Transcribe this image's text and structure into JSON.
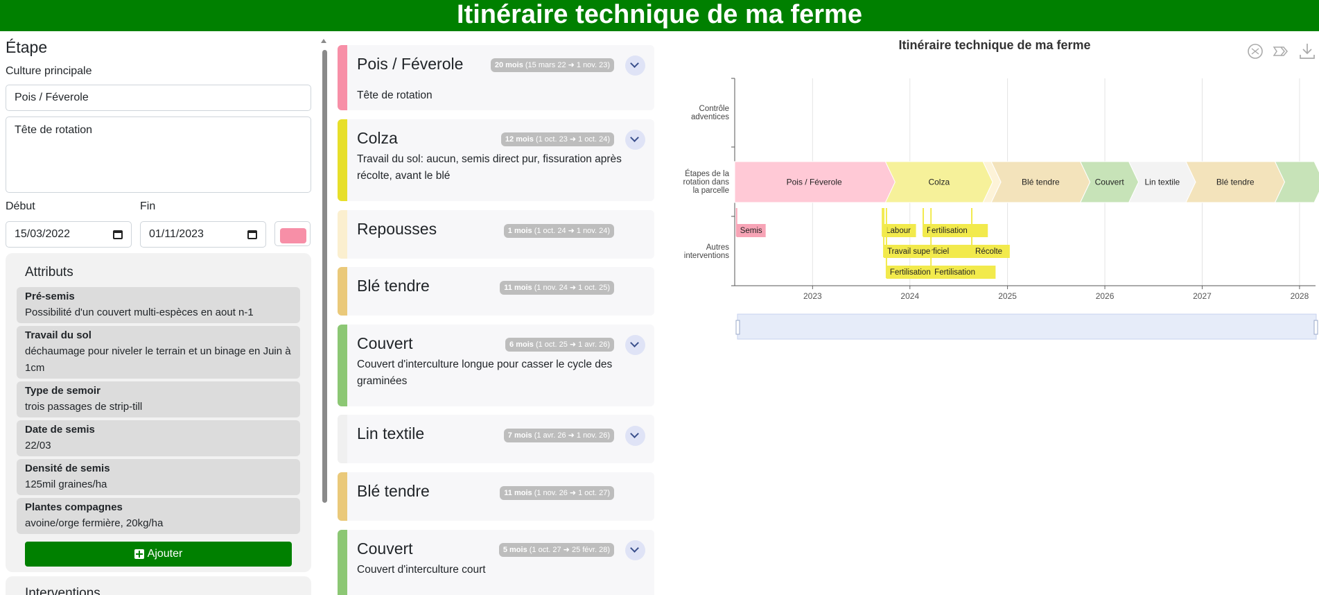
{
  "app_title": "Itinéraire technique de ma ferme",
  "form": {
    "title": "Étape",
    "culture_label": "Culture principale",
    "culture_value": "Pois / Féverole",
    "description_value": "Tête de rotation",
    "start_label": "Début",
    "end_label": "Fin",
    "start_value": "15/03/2022",
    "end_value": "01/11/2023",
    "color": "#f78fa7",
    "attributes_title": "Attributs",
    "attributes": [
      {
        "name": "Pré-semis",
        "value": "Possibilité d'un couvert multi-espèces en aout n-1"
      },
      {
        "name": "Travail du sol",
        "value": "déchaumage pour niveler le terrain et un binage en Juin à 1cm"
      },
      {
        "name": "Type de semoir",
        "value": "trois passages de strip-till"
      },
      {
        "name": "Date de semis",
        "value": "22/03"
      },
      {
        "name": "Densité de semis",
        "value": "125mil graines/ha"
      },
      {
        "name": "Plantes compagnes",
        "value": "avoine/orge fermière, 20kg/ha"
      }
    ],
    "add_button": "Ajouter",
    "next_section_title": "Interventions"
  },
  "steps": [
    {
      "name": "Pois / Féverole",
      "duration": "20 mois",
      "dates": "(15 mars 22 ➜ 1 nov. 23)",
      "desc": "Tête de rotation",
      "color": "#f78fa7"
    },
    {
      "name": "Colza",
      "duration": "12 mois",
      "dates": "(1 oct. 23 ➜ 1 oct. 24)",
      "desc": "Travail du sol: aucun, semis direct pur, fissuration après récolte, avant le blé",
      "color": "#e7df2a"
    },
    {
      "name": "Repousses",
      "duration": "1 mois",
      "dates": "(1 oct. 24 ➜ 1 nov. 24)",
      "desc": "",
      "color": "#fbefcf"
    },
    {
      "name": "Blé tendre",
      "duration": "11 mois",
      "dates": "(1 nov. 24 ➜ 1 oct. 25)",
      "desc": "",
      "color": "#eac97a"
    },
    {
      "name": "Couvert",
      "duration": "6 mois",
      "dates": "(1 oct. 25 ➜ 1 avr. 26)",
      "desc": "Couvert d'interculture longue pour casser le cycle des graminées",
      "color": "#8cc774"
    },
    {
      "name": "Lin textile",
      "duration": "7 mois",
      "dates": "(1 avr. 26 ➜ 1 nov. 26)",
      "desc": "",
      "color": "#f0f0f0"
    },
    {
      "name": "Blé tendre",
      "duration": "11 mois",
      "dates": "(1 nov. 26 ➜ 1 oct. 27)",
      "desc": "",
      "color": "#eac97a"
    },
    {
      "name": "Couvert",
      "duration": "5 mois",
      "dates": "(1 oct. 27 ➜ 25 févr. 28)",
      "desc": "Couvert d'interculture court",
      "color": "#8cc774"
    }
  ],
  "chart_data": {
    "type": "gantt",
    "title": "Itinéraire technique de ma ferme",
    "rows": [
      "Contrôle adventices",
      "Étapes de la rotation dans la parcelle",
      "Autres interventions"
    ],
    "x_ticks": [
      "2023",
      "2024",
      "2025",
      "2026",
      "2027",
      "2028"
    ],
    "xlim": [
      "2022-03-15",
      "2028-03-01"
    ],
    "rotation": [
      {
        "label": "Pois / Féverole",
        "start": "2022-03-15",
        "end": "2023-11-01",
        "color": "#ffc9d6"
      },
      {
        "label": "Colza",
        "start": "2023-10-01",
        "end": "2024-10-01",
        "color": "#f6f19a"
      },
      {
        "label": "",
        "start": "2024-10-01",
        "end": "2024-11-01",
        "color": "#fdf3d8"
      },
      {
        "label": "Blé tendre",
        "start": "2024-11-01",
        "end": "2025-10-01",
        "color": "#f3e3bb"
      },
      {
        "label": "Couvert",
        "start": "2025-10-01",
        "end": "2026-04-01",
        "color": "#c7e3b8"
      },
      {
        "label": "Lin textile",
        "start": "2026-04-01",
        "end": "2026-11-01",
        "color": "#f3f3f3"
      },
      {
        "label": "Blé tendre",
        "start": "2026-11-01",
        "end": "2027-10-01",
        "color": "#f3e3bb"
      },
      {
        "label": "",
        "start": "2027-10-01",
        "end": "2028-02-25",
        "color": "#c7e3b8"
      }
    ],
    "interventions": [
      {
        "label": "Semis",
        "date": "2022-03-22",
        "lane": 0,
        "color": "#f7a4b6"
      },
      {
        "label": "Labour",
        "date": "2023-09-20",
        "lane": 0,
        "color": "#f2ea4c"
      },
      {
        "label": "Travail superficiel",
        "date": "2023-09-25",
        "lane": 1,
        "color": "#f2ea4c"
      },
      {
        "label": "Fertilisation",
        "date": "2023-10-05",
        "lane": 2,
        "color": "#f2ea4c"
      },
      {
        "label": "Fertilisation",
        "date": "2024-02-20",
        "lane": 0,
        "color": "#f2ea4c"
      },
      {
        "label": "Fertilisation",
        "date": "2024-03-20",
        "lane": 2,
        "color": "#f2ea4c"
      },
      {
        "label": "Récolte",
        "date": "2024-08-20",
        "lane": 1,
        "color": "#f2ea4c"
      }
    ]
  }
}
